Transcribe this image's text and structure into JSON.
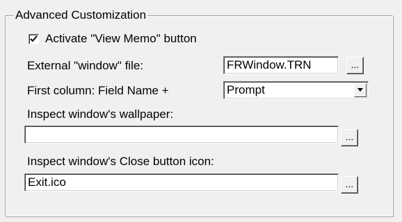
{
  "group": {
    "title": "Advanced Customization"
  },
  "activate_view_memo": {
    "label": "Activate \"View Memo\" button",
    "checked": true
  },
  "external_window_file": {
    "label": "External \"window\" file:",
    "value": "FRWindow.TRN",
    "browse_label": "..."
  },
  "first_column": {
    "label": "First column: Field Name +",
    "value": "Prompt"
  },
  "wallpaper": {
    "label": "Inspect window's wallpaper:",
    "value": "",
    "browse_label": "..."
  },
  "close_icon": {
    "label": "Inspect window's Close button icon:",
    "value": "Exit.ico",
    "browse_label": "..."
  }
}
